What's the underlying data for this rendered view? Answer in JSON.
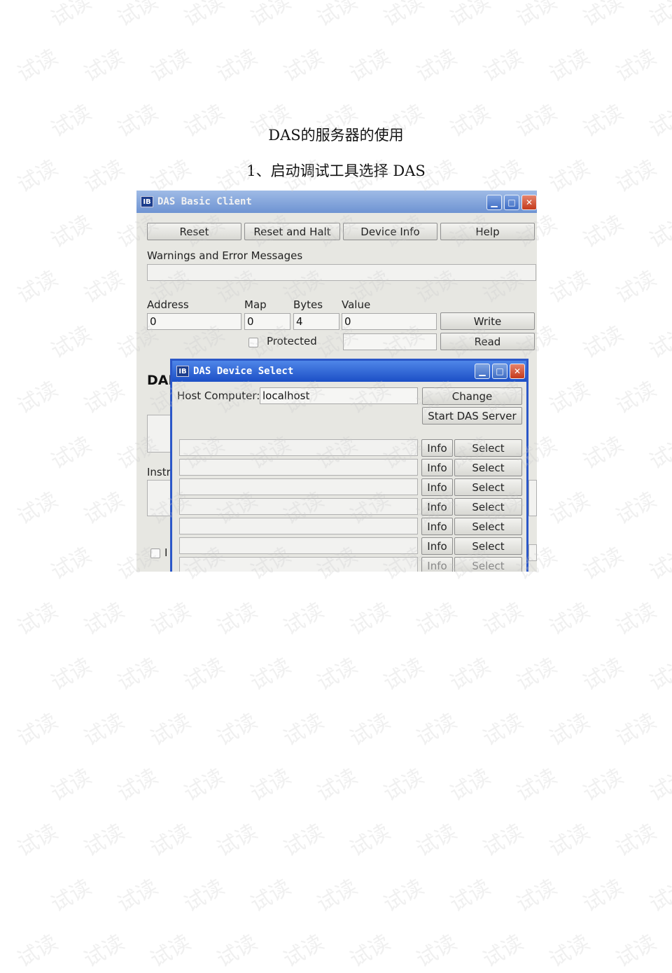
{
  "document": {
    "title": "DAS的服务器的使用",
    "step_1": "1、启动调试工具选择 DAS"
  },
  "watermark_text": "试读",
  "basic_client": {
    "window_title": "DAS Basic Client",
    "app_icon": "app-icon",
    "buttons": [
      "Reset",
      "Reset and Halt",
      "Device Info",
      "Help"
    ],
    "messages_label": "Warnings and Error Messages",
    "address_label": "Address",
    "map_label": "Map",
    "bytes_label": "Bytes",
    "value_label": "Value",
    "address_value": "0",
    "map_value": "0",
    "bytes_value": "4",
    "value_value": "0",
    "write_button": "Write",
    "read_button": "Read",
    "protected_label": "Protected",
    "das_fragment": "DAI",
    "instr_fragment": "Instr",
    "check_fragment": "I"
  },
  "device_select": {
    "window_title": "DAS Device Select",
    "host_label": "Host Computer:",
    "host_value": "localhost",
    "change_button": "Change",
    "start_button": "Start DAS Server",
    "rows": [
      {
        "info": "Info",
        "select": "Select"
      },
      {
        "info": "Info",
        "select": "Select"
      },
      {
        "info": "Info",
        "select": "Select"
      },
      {
        "info": "Info",
        "select": "Select"
      },
      {
        "info": "Info",
        "select": "Select"
      },
      {
        "info": "Info",
        "select": "Select"
      },
      {
        "info": "Info",
        "select": "Select"
      }
    ]
  },
  "colors": {
    "client_titlebar": "#7fa0d8",
    "dialog_titlebar": "#2b57c8",
    "close_button": "#d0502f",
    "window_body": "#e7e7e2"
  }
}
